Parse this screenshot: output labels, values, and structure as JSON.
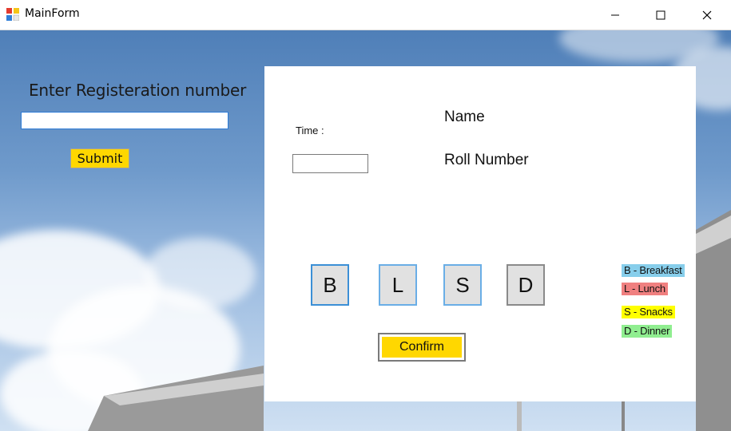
{
  "window": {
    "title": "MainForm",
    "buttons": [
      "minimize",
      "maximize",
      "close"
    ]
  },
  "left": {
    "prompt": "Enter Registeration number",
    "reg_value": "",
    "submit_label": "Submit"
  },
  "panel": {
    "time_label": "Time :",
    "time_value": "",
    "name_label": "Name",
    "roll_label": "Roll Number",
    "meals": [
      "B",
      "L",
      "S",
      "D"
    ],
    "confirm_label": "Confirm",
    "legend": [
      {
        "text": "B - Breakfast",
        "color": "#87ceeb"
      },
      {
        "text": "L - Lunch",
        "color": "#f08080"
      },
      {
        "text": "S - Snacks",
        "color": "#ffff00"
      },
      {
        "text": "D - Dinner",
        "color": "#90ee90"
      }
    ]
  },
  "colors": {
    "submit_bg": "#ffd700",
    "confirm_bg": "#ffd700",
    "focus_border": "#2d7bd6"
  }
}
